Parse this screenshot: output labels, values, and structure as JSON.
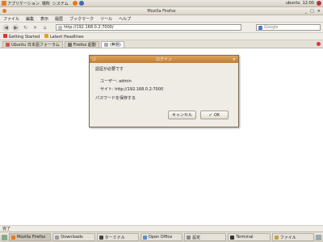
{
  "top_panel": {
    "applications_label": "アプリケーション",
    "places_label": "場所",
    "system_label": "システム",
    "user_label": "ubuntu",
    "clock": "12:00"
  },
  "window": {
    "title": "Mozilla Firefox",
    "menu": [
      "ファイル",
      "編集",
      "表示",
      "履歴",
      "ブックマーク",
      "ツール",
      "ヘルプ"
    ],
    "url": "http://192.168.0.2:7000/",
    "search_placeholder": "Google",
    "bookmarks": [
      "Getting Started",
      "Latest Headlines"
    ],
    "tabs": [
      {
        "label": "Ubuntu 日本語フォーラム"
      },
      {
        "label": "Firefox 起動"
      },
      {
        "label": "(無題)"
      }
    ],
    "status": "完了"
  },
  "dialog": {
    "title": "ログイン",
    "intro": "認証が必要です",
    "user_label": "ユーザー: admin",
    "site_label": "サイト: http://192.168.0.2:7000",
    "remember_label": "パスワードを保存する",
    "cancel_label": "キャンセル",
    "ok_label": "OK"
  },
  "taskbar": {
    "items": [
      {
        "label": "Mozilla Firefox",
        "active": true
      },
      {
        "label": "Downloads"
      },
      {
        "label": "ターミナル"
      },
      {
        "label": "Open Office"
      },
      {
        "label": "設定"
      },
      {
        "label": "Terminal"
      },
      {
        "label": "ファイル"
      }
    ]
  },
  "colors": {
    "accent": "#c27c2e",
    "panel": "#e1ddd4"
  }
}
